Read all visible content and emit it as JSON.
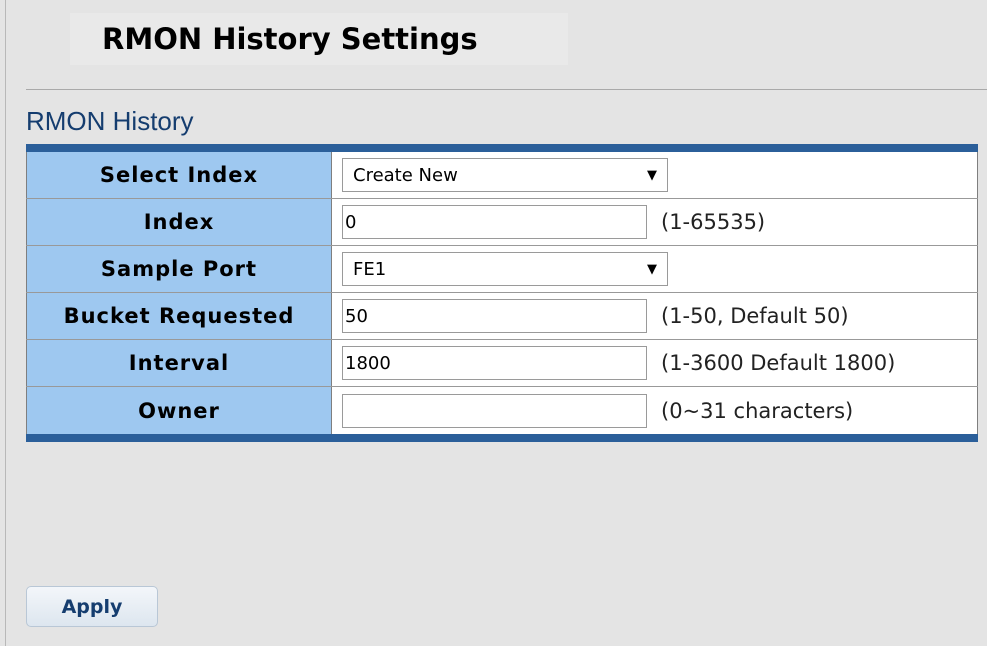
{
  "page_title": "RMON History Settings",
  "section_title": "RMON History",
  "form": {
    "select_index": {
      "label": "Select Index",
      "value": "Create New"
    },
    "index": {
      "label": "Index",
      "value": "0",
      "hint": "(1-65535)"
    },
    "sample_port": {
      "label": "Sample Port",
      "value": "FE1"
    },
    "bucket_requested": {
      "label": "Bucket Requested",
      "value": "50",
      "hint": "(1-50, Default 50)"
    },
    "interval": {
      "label": "Interval",
      "value": "1800",
      "hint": "(1-3600 Default 1800)"
    },
    "owner": {
      "label": "Owner",
      "value": "",
      "hint": "(0~31 characters)"
    }
  },
  "apply_label": "Apply",
  "colors": {
    "header_blue": "#2b5f9a",
    "label_bg": "#9ec8f0",
    "title_blue": "#153d6f",
    "page_bg": "#e4e4e4"
  },
  "icons": {
    "dropdown": "triangle-down-icon"
  }
}
